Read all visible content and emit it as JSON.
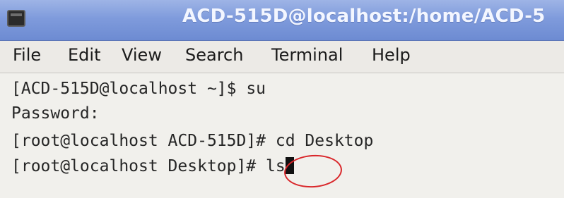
{
  "window": {
    "title": "ACD-515D@localhost:/home/ACD-5",
    "title_color": "#f3f6ff",
    "titlebar_color": "#7f9bdc",
    "app_icon": "terminal-icon"
  },
  "menubar": {
    "items": [
      "File",
      "Edit",
      "View",
      "Search",
      "Terminal",
      "Help"
    ]
  },
  "terminal": {
    "lines": [
      "[ACD-515D@localhost ~]$ su",
      "Password:",
      "[root@localhost ACD-515D]# cd Desktop",
      "[root@localhost Desktop]# "
    ],
    "current_input": "ls",
    "annotation_color": "#d9262a"
  }
}
